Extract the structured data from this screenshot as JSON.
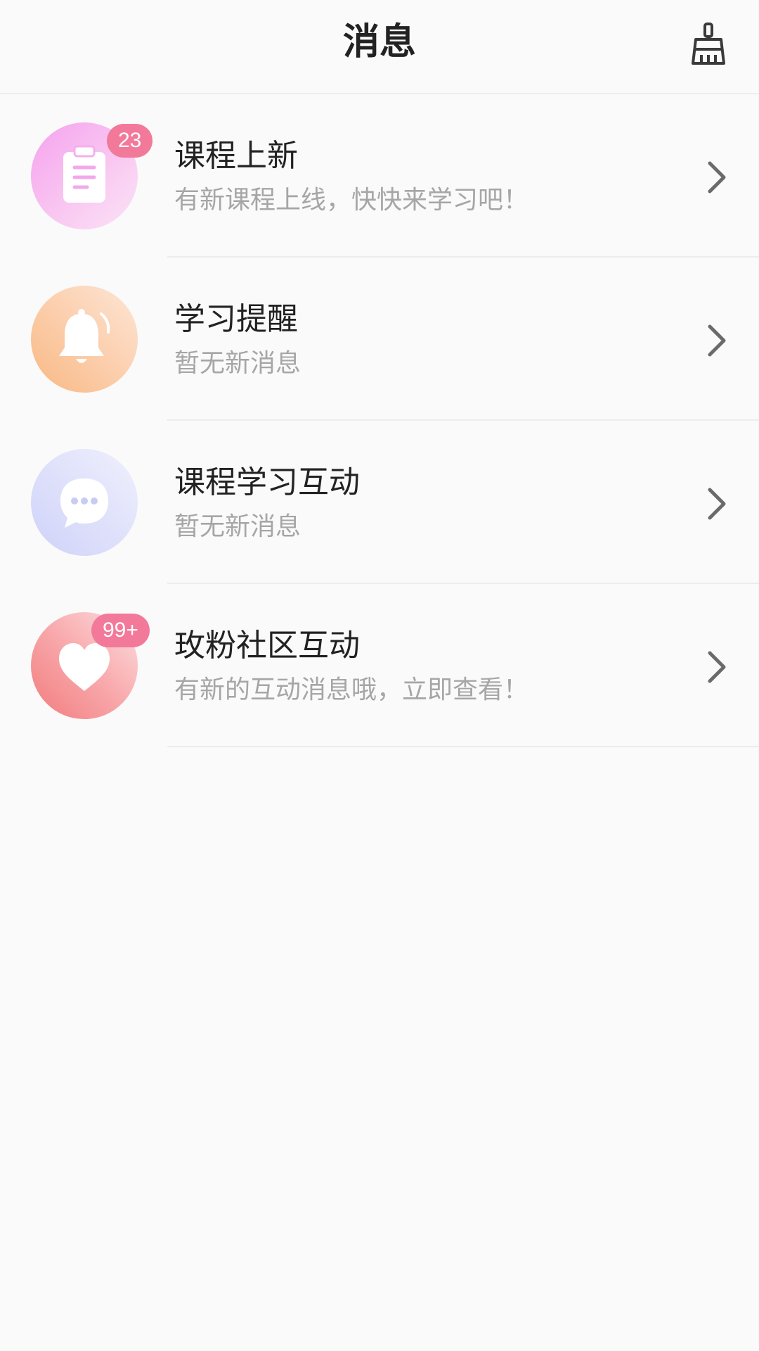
{
  "header": {
    "title": "消息",
    "clear_icon": "broom-icon"
  },
  "messages": [
    {
      "title": "课程上新",
      "subtitle": "有新课程上线，快快来学习吧！",
      "badge": "23",
      "icon": "clipboard-icon",
      "color": "#f5a2ee"
    },
    {
      "title": "学习提醒",
      "subtitle": "暂无新消息",
      "badge": null,
      "icon": "bell-icon",
      "color": "#f8b884"
    },
    {
      "title": "课程学习互动",
      "subtitle": "暂无新消息",
      "badge": null,
      "icon": "chat-bubble-icon",
      "color": "#cfd2f8"
    },
    {
      "title": "玫粉社区互动",
      "subtitle": "有新的互动消息哦，立即查看！",
      "badge": "99+",
      "icon": "heart-icon",
      "color": "#f27b7d"
    }
  ],
  "colors": {
    "badge": "#f2799a",
    "title_text": "#222222",
    "subtitle_text": "#a6a6a6",
    "background": "#fafafa"
  }
}
